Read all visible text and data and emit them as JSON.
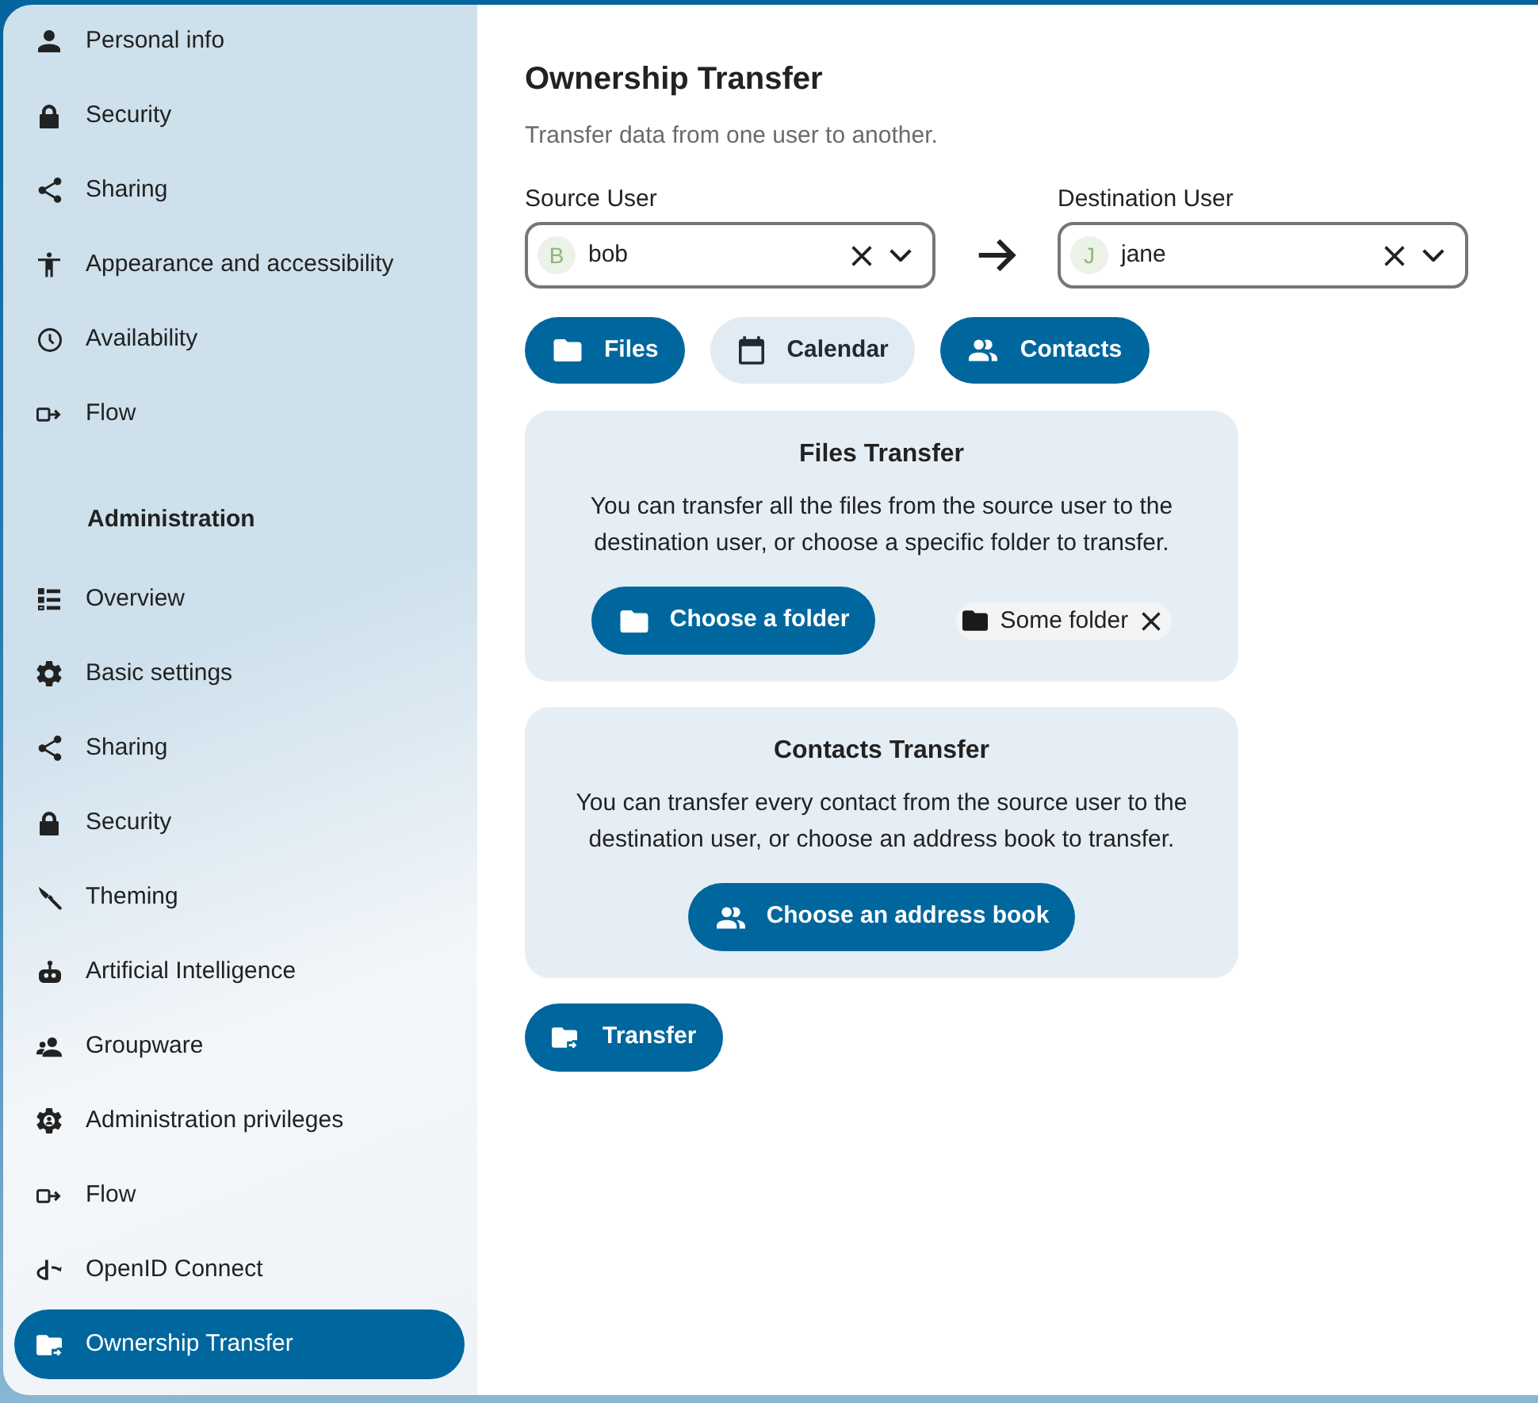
{
  "sidebar": {
    "sections": [
      {
        "items": [
          {
            "label": "Personal info",
            "selected": false
          },
          {
            "label": "Security",
            "selected": false
          },
          {
            "label": "Sharing",
            "selected": false
          },
          {
            "label": "Appearance and accessibility",
            "selected": false
          },
          {
            "label": "Availability",
            "selected": false
          },
          {
            "label": "Flow",
            "selected": false
          }
        ]
      },
      {
        "heading": "Administration",
        "items": [
          {
            "label": "Overview",
            "selected": false
          },
          {
            "label": "Basic settings",
            "selected": false
          },
          {
            "label": "Sharing",
            "selected": false
          },
          {
            "label": "Security",
            "selected": false
          },
          {
            "label": "Theming",
            "selected": false
          },
          {
            "label": "Artificial Intelligence",
            "selected": false
          },
          {
            "label": "Groupware",
            "selected": false
          },
          {
            "label": "Administration privileges",
            "selected": false
          },
          {
            "label": "Flow",
            "selected": false
          },
          {
            "label": "OpenID Connect",
            "selected": false
          },
          {
            "label": "Ownership Transfer",
            "selected": true
          }
        ]
      }
    ]
  },
  "main": {
    "title": "Ownership Transfer",
    "subtitle": "Transfer data from one user to another.",
    "source_user": {
      "label": "Source User",
      "avatar": "B",
      "value": "bob"
    },
    "destination_user": {
      "label": "Destination User",
      "avatar": "J",
      "value": "jane"
    },
    "toggles": [
      {
        "label": "Files",
        "selected": true
      },
      {
        "label": "Calendar",
        "selected": false
      },
      {
        "label": "Contacts",
        "selected": true
      }
    ],
    "cards": [
      {
        "kind": "files",
        "title": "Files Transfer",
        "description": "You can transfer all the files from the source user to the destination user, or choose a specific folder to transfer.",
        "button": "Choose a folder",
        "chip": {
          "label": "Some folder"
        }
      },
      {
        "kind": "contacts",
        "title": "Contacts Transfer",
        "description": "You can transfer every contact from the source user to the destination user, or choose an address book to transfer.",
        "button": "Choose an address book"
      }
    ],
    "transfer_button": "Transfer"
  }
}
